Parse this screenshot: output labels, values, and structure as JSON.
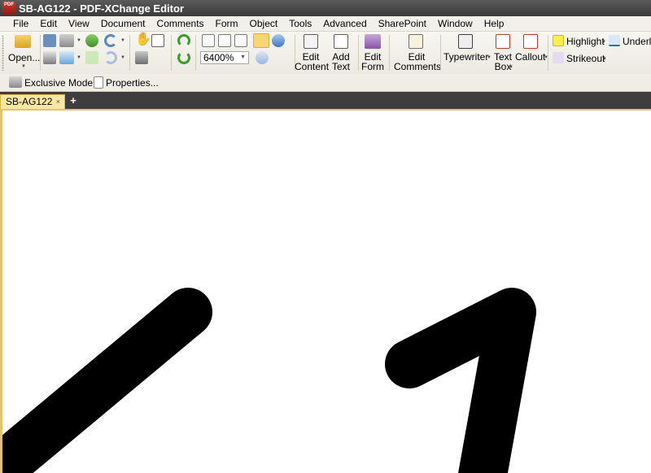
{
  "window": {
    "title": "SB-AG122 - PDF-XChange Editor",
    "app_icon_text": "PDF"
  },
  "menu": [
    "File",
    "Edit",
    "View",
    "Document",
    "Comments",
    "Form",
    "Object",
    "Tools",
    "Advanced",
    "SharePoint",
    "Window",
    "Help"
  ],
  "ribbon": {
    "open_label": "Open...",
    "zoom_value": "6400%",
    "edit_content": [
      "Edit",
      "Content"
    ],
    "add_text": [
      "Add",
      "Text"
    ],
    "edit_form": [
      "Edit",
      "Form"
    ],
    "edit_comments": [
      "Edit",
      "Comments"
    ],
    "typewriter": "Typewriter",
    "text_box": [
      "Text",
      "Box"
    ],
    "callout": "Callout",
    "highlight": "Highlight",
    "underline": "Underli",
    "strikeout": "Strikeout"
  },
  "toolbar2": {
    "exclusive_mode": "Exclusive Mode",
    "properties": "Properties..."
  },
  "tabs": {
    "active": "SB-AG122",
    "close_glyph": "×",
    "new_glyph": "+"
  }
}
